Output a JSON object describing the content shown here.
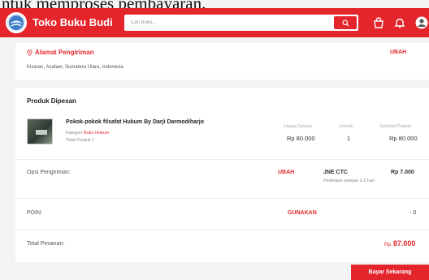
{
  "caption": {
    "text": "ntuk memproses pembayaran."
  },
  "navbar": {
    "brand": "Toko Buku Budi",
    "search_placeholder": "Cari Buku...",
    "bg_color": "#e4262c",
    "icons": [
      "logo-globe-icon",
      "search-icon",
      "bag-icon",
      "bell-icon",
      "user-avatar-icon"
    ]
  },
  "address": {
    "title": "Alamat Pengiriman",
    "value": "Kisaran, Asahan, Sumatera Utara, Indonesia",
    "action": "UBAH",
    "icon": "location-pin-icon"
  },
  "order": {
    "title": "Produk Dipesan",
    "columns": {
      "unit_price": "Harga Satuan",
      "qty": "Jumlah",
      "subtotal": "Subtotal Produk"
    },
    "product": {
      "name": "Pokok-pokok filsafat Hukum By Darji Darmodiharjo",
      "category_label": "Kategori",
      "category_value": "Buku Hukum",
      "total_label": "Total Produk 1",
      "unit_price": "Rp 80.000",
      "qty": "1",
      "subtotal": "Rp 80.000"
    },
    "shipping": {
      "label": "Opsi Pengiriman:",
      "action": "UBAH",
      "courier": "JNE CTC",
      "estimate": "Perkiraan sampai 1-2 hari",
      "price": "Rp 7.000"
    },
    "points": {
      "label": "POIN:",
      "action": "GUNAKAN",
      "value": "- 0"
    },
    "total": {
      "label": "Total Pesanan:",
      "currency": "Rp",
      "amount": "87.000"
    }
  },
  "pay_button": {
    "label": "Bayar Sekarang"
  }
}
